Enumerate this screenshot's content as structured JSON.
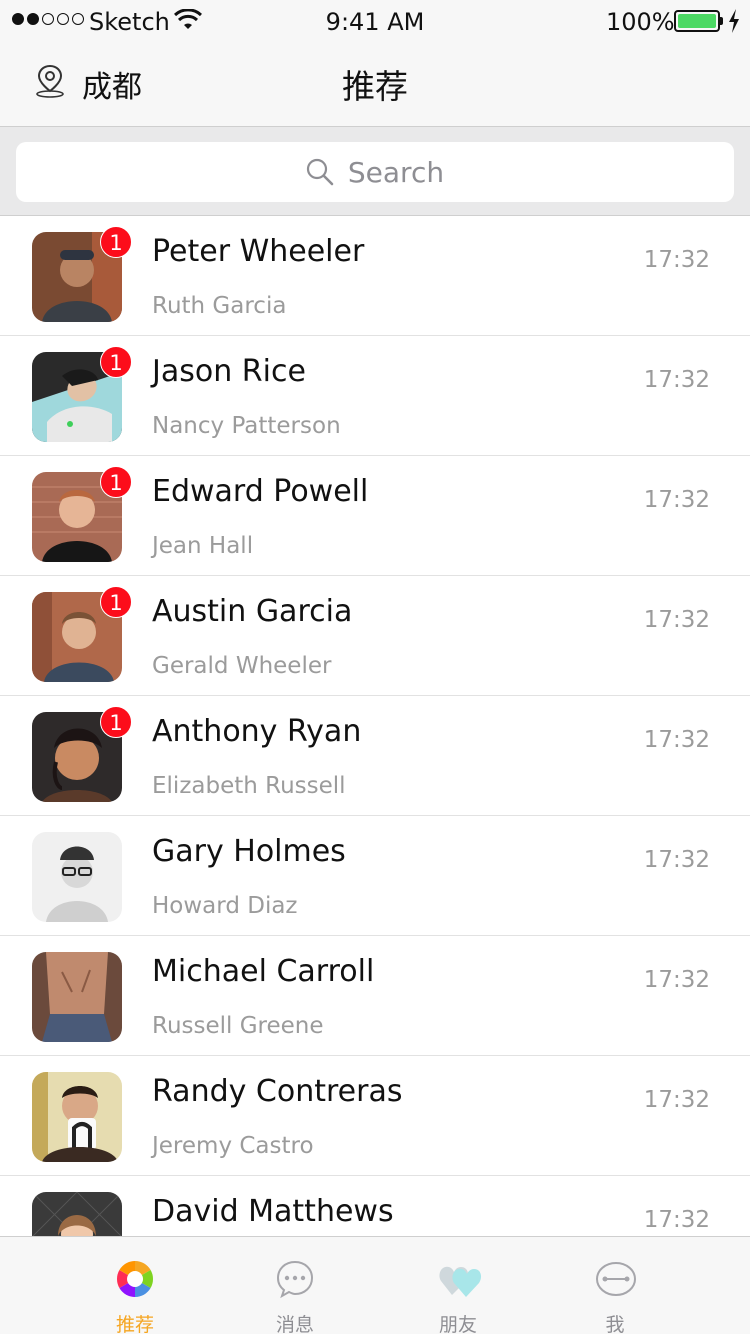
{
  "status_bar": {
    "carrier": "Sketch",
    "time": "9:41 AM",
    "battery": "100%"
  },
  "nav": {
    "city": "成都",
    "title": "推荐"
  },
  "search": {
    "placeholder": "Search"
  },
  "contacts": [
    {
      "name": "Peter Wheeler",
      "subtitle": "Ruth Garcia",
      "time": "17:32",
      "badge": "1"
    },
    {
      "name": "Jason Rice",
      "subtitle": "Nancy Patterson",
      "time": "17:32",
      "badge": "1"
    },
    {
      "name": "Edward Powell",
      "subtitle": "Jean Hall",
      "time": "17:32",
      "badge": "1"
    },
    {
      "name": "Austin Garcia",
      "subtitle": "Gerald Wheeler",
      "time": "17:32",
      "badge": "1"
    },
    {
      "name": "Anthony Ryan",
      "subtitle": "Elizabeth Russell",
      "time": "17:32",
      "badge": "1"
    },
    {
      "name": "Gary Holmes",
      "subtitle": "Howard Diaz",
      "time": "17:32",
      "badge": ""
    },
    {
      "name": "Michael Carroll",
      "subtitle": "Russell Greene",
      "time": "17:32",
      "badge": ""
    },
    {
      "name": "Randy Contreras",
      "subtitle": "Jeremy Castro",
      "time": "17:32",
      "badge": ""
    },
    {
      "name": "David Matthews",
      "subtitle": "",
      "time": "17:32",
      "badge": ""
    }
  ],
  "tabs": [
    {
      "label": "推荐",
      "icon": "colorful-wheel-icon",
      "active": true
    },
    {
      "label": "消息",
      "icon": "chat-bubble-icon",
      "active": false
    },
    {
      "label": "朋友",
      "icon": "hearts-icon",
      "active": false
    },
    {
      "label": "我",
      "icon": "profile-icon",
      "active": false
    }
  ],
  "colors": {
    "badge": "#fc0d1b",
    "active_tab": "#f5a623",
    "battery": "#4cd964"
  }
}
